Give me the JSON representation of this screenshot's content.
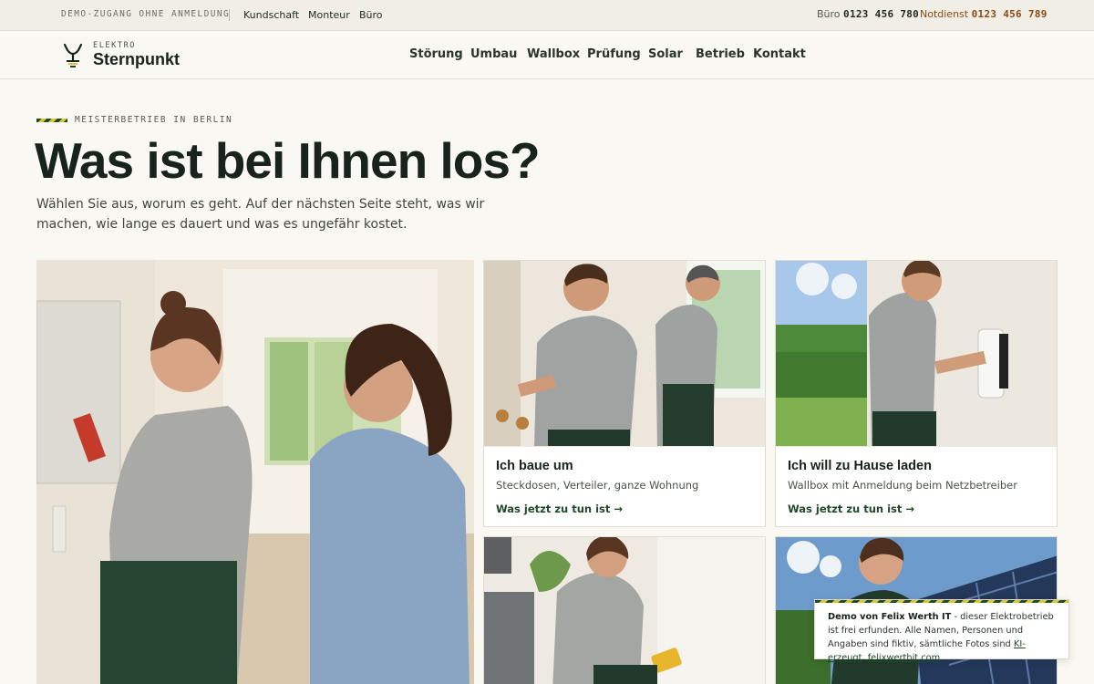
{
  "topbar": {
    "demo_text": "DEMO-ZUGANG OHNE ANMELDUNG",
    "roles": [
      "Kundschaft",
      "Monteur",
      "Büro"
    ],
    "office_label": "Büro",
    "office_phone": "0123 456 780",
    "emergency_label": "Notdienst",
    "emergency_phone": "0123 456 789"
  },
  "header": {
    "logo_small": "ELEKTRO",
    "logo_big": "Sternpunkt",
    "nav": [
      "Störung",
      "Umbau",
      "Wallbox",
      "Prüfung",
      "Solar",
      "Betrieb",
      "Kontakt"
    ]
  },
  "hero": {
    "eyebrow": "MEISTERBETRIEB IN BERLIN",
    "title": "Was ist bei Ihnen los?",
    "lead": "Wählen Sie aus, worum es geht. Auf der nächsten Seite steht, was wir machen, wie lange es dauert und was es ungefähr kostet."
  },
  "cards": [
    {
      "title": "Ich baue um",
      "subtitle": "Steckdosen, Verteiler, ganze Wohnung",
      "link": "Was jetzt zu tun ist →"
    },
    {
      "title": "Ich will zu Hause laden",
      "subtitle": "Wallbox mit Anmeldung beim Netzbetreiber",
      "link": "Was jetzt zu tun ist →"
    }
  ],
  "notice": {
    "author": "Demo von Felix Werth IT",
    "text": " - dieser Elektrobetrieb ist frei erfunden. Alle Namen, Personen und Angaben sind fiktiv, sämtliche Fotos sind ",
    "link1": "KI-erzeugt",
    "sep": ". ",
    "link2": "felixwerthit.com"
  },
  "colors": {
    "brand_green": "#1f4a28",
    "accent_yellow": "#d9c43a",
    "emergency": "#8a4a12",
    "background": "#faf8f2"
  }
}
